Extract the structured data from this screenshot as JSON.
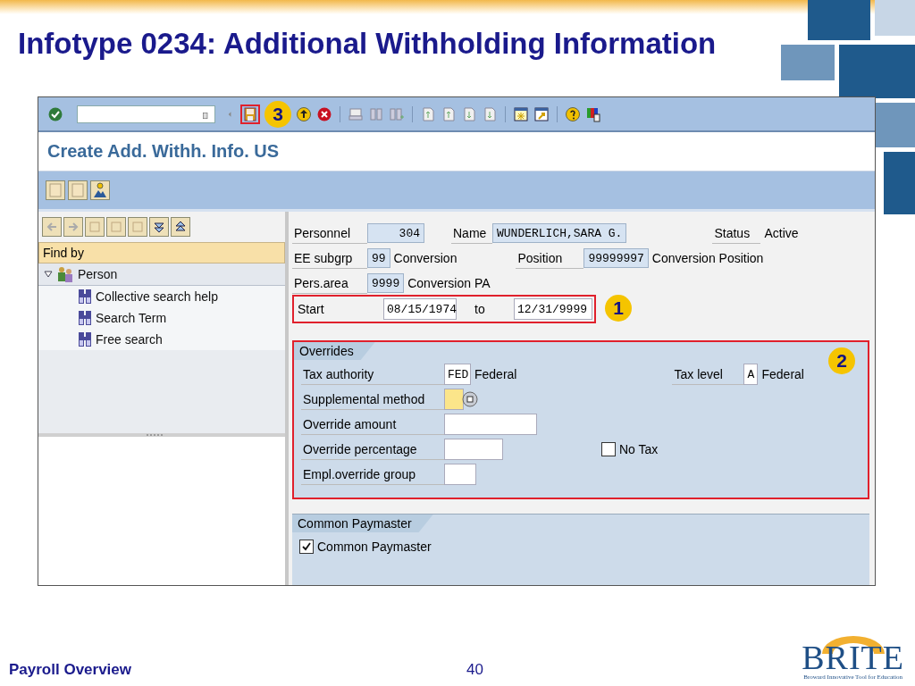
{
  "slide": {
    "title": "Infotype 0234: Additional Withholding Information",
    "footer": "Payroll Overview",
    "page": "40",
    "logo": {
      "name": "BRITE",
      "tagline": "Broward Innovative Tool for Education"
    }
  },
  "window": {
    "toolbar": {
      "callout": "3"
    },
    "title": "Create Add. Withh. Info. US"
  },
  "navigator": {
    "header": "Find by",
    "tree": [
      {
        "label": "Person",
        "expanded": true,
        "children": [
          {
            "label": "Collective search help"
          },
          {
            "label": "Search Term"
          },
          {
            "label": "Free search"
          }
        ]
      }
    ]
  },
  "header": {
    "personnel": {
      "label": "Personnel",
      "value": "304"
    },
    "name": {
      "label": "Name",
      "value": "WUNDERLICH,SARA G."
    },
    "status": {
      "label": "Status",
      "value": "Active"
    },
    "ee_subgroup": {
      "label": "EE subgrp",
      "value": "99",
      "text": "Conversion"
    },
    "position": {
      "label": "Position",
      "value": "99999997",
      "text": "Conversion Position"
    },
    "pers_area": {
      "label": "Pers.area",
      "value": "9999",
      "text": "Conversion PA"
    }
  },
  "period": {
    "start_label": "Start",
    "start": "08/15/1974",
    "to_label": "to",
    "end": "12/31/9999",
    "callout": "1"
  },
  "overrides": {
    "title": "Overrides",
    "callout": "2",
    "tax_authority": {
      "label": "Tax authority",
      "value": "FED",
      "text": "Federal"
    },
    "tax_level": {
      "label": "Tax level",
      "value": "A",
      "text": "Federal"
    },
    "supplemental_method": {
      "label": "Supplemental method",
      "focused": true
    },
    "override_amount": {
      "label": "Override amount"
    },
    "override_percentage": {
      "label": "Override percentage"
    },
    "empl_override_group": {
      "label": "Empl.override group"
    },
    "no_tax": {
      "label": "No Tax",
      "checked": false
    }
  },
  "common_paymaster": {
    "title": "Common Paymaster",
    "checkbox": {
      "label": "Common Paymaster",
      "checked": true
    }
  }
}
